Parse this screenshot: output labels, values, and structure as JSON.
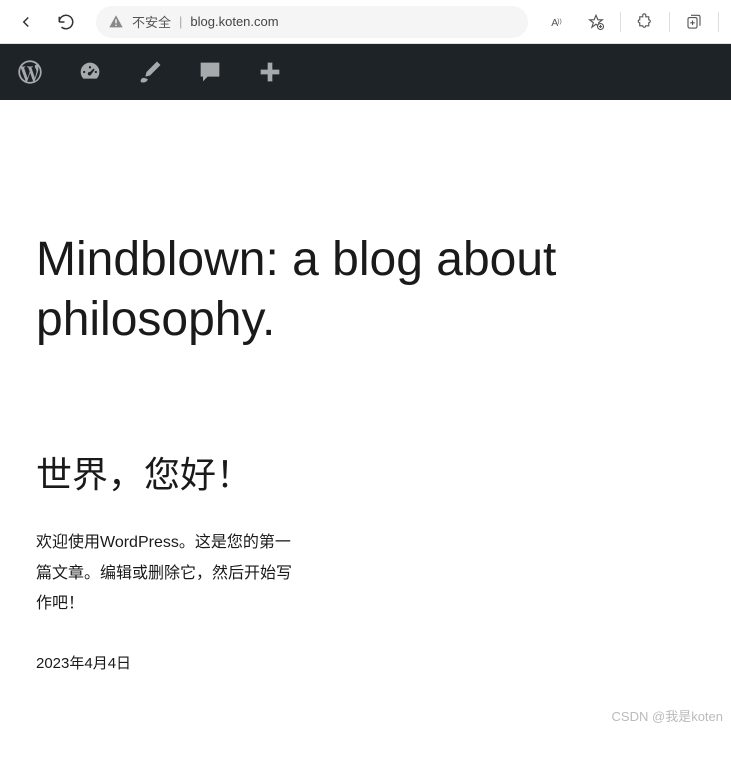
{
  "browser": {
    "insecure_label": "不安全",
    "url": "blog.koten.com"
  },
  "content": {
    "page_title": "Mindblown: a blog about philosophy.",
    "post_title": "世界，您好！",
    "post_excerpt": "欢迎使用WordPress。这是您的第一篇文章。编辑或删除它，然后开始写作吧！",
    "post_date": "2023年4月4日"
  },
  "watermark": "CSDN @我是koten"
}
